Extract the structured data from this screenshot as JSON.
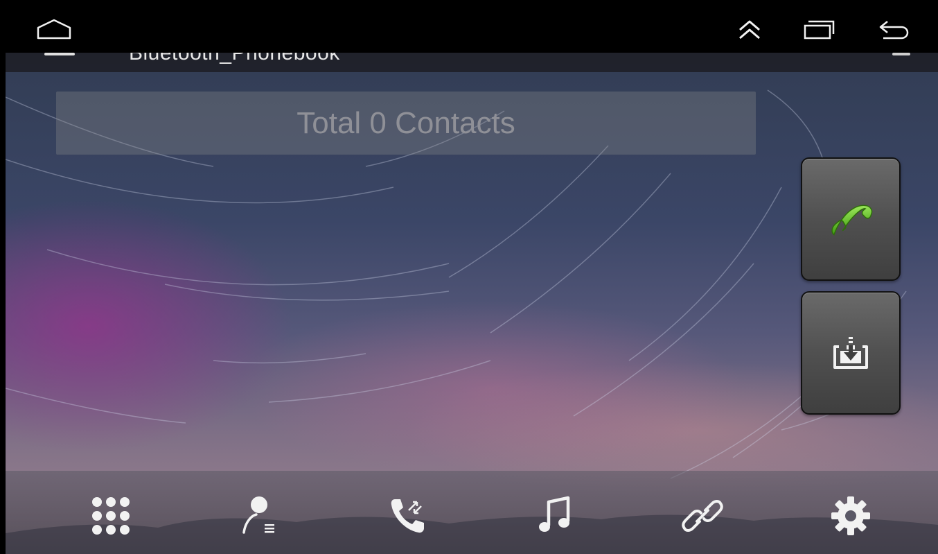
{
  "app": {
    "title": "Bluetooth_Phonebook"
  },
  "contacts": {
    "summary": "Total 0 Contacts"
  },
  "system_bar": {
    "left": [
      "home-outline-icon"
    ],
    "right": [
      "chevron-up-double-icon",
      "recent-apps-icon",
      "back-icon"
    ]
  },
  "side_actions": [
    {
      "name": "call",
      "icon": "phone-icon",
      "color": "#5ec21d"
    },
    {
      "name": "download-contacts",
      "icon": "download-tray-icon"
    }
  ],
  "bottom_nav": [
    {
      "name": "dialpad",
      "icon": "dialpad-icon"
    },
    {
      "name": "contacts",
      "icon": "contacts-icon",
      "active": true
    },
    {
      "name": "call-log",
      "icon": "call-log-icon"
    },
    {
      "name": "bt-music",
      "icon": "music-note-icon"
    },
    {
      "name": "connection",
      "icon": "link-icon"
    },
    {
      "name": "settings",
      "icon": "gear-icon"
    }
  ],
  "colors": {
    "status_bar": "#000000",
    "call_green": "#5ec21d",
    "icon_white": "#f2f2f2"
  }
}
